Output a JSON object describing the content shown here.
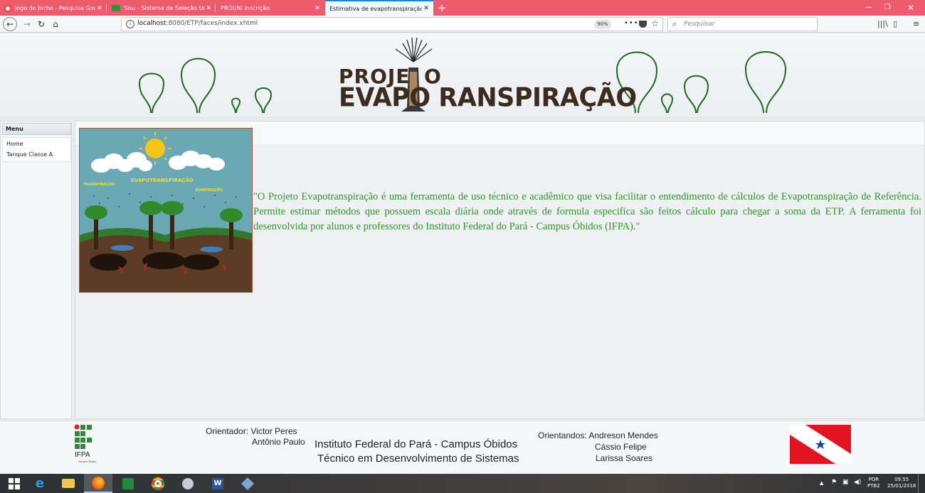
{
  "browser": {
    "tabs": [
      {
        "label": "jogo do bicho - Pesquisa Goog",
        "favicon": "google-icon"
      },
      {
        "label": "Sisu - Sistema de Seleção Unifi",
        "favicon": "brazil-flag-icon"
      },
      {
        "label": "PROUNI inscrição",
        "favicon": ""
      },
      {
        "label": "Estimativa de evapotranspiração",
        "favicon": ""
      }
    ],
    "url_host": "localhost",
    "url_path": ":8080/ETP/faces/index.xhtml",
    "zoom": "90%",
    "search_placeholder": "Pesquisar"
  },
  "header": {
    "logo_line1": "PROJE",
    "logo_line1_end": "O",
    "logo_line2": "EVAPO  RANSPIRAÇÃO"
  },
  "sidebar": {
    "title": "Menu",
    "items": [
      "Home",
      "Tanque Classe A"
    ]
  },
  "illustration": {
    "label_center": "EVAPOTRANSPIRAÇÃO",
    "label_left": "TRANSPIRAÇÃO",
    "label_right": "EVAPORAÇÃO"
  },
  "main": {
    "quote": "\"O Projeto Evapotranspiração é uma ferramenta de uso técnico e acadêmico que visa facilitar o entendimento de cálculos de Evapotranspiração de Referência. Permite estimar métodos que possuem escala diária onde através de formula especifica são feitos cálculo para chegar a soma da ETP. A ferramenta foi desenvolvida por alunos e professores do Instituto Federal do Pará - Campus Óbidos (IFPA).\""
  },
  "footer": {
    "ifpa_label": "IFPA",
    "ifpa_sub": "Campus Óbidos",
    "orientador_label": "Orientador: Victor Peres",
    "orientador_2": "Antônio Paulo",
    "institution": "Instituto Federal do Pará - Campus Óbidos",
    "course": "Técnico em Desenvolvimento de Sistemas",
    "orientandos_label": "Orientandos: Andreson Mendes",
    "orientando_2": "Cássio Felipe",
    "orientando_3": "Larissa Soares"
  },
  "taskbar": {
    "lang": "POR",
    "lang2": "PTB2",
    "time": "09:55",
    "date": "25/01/2018"
  },
  "colors": {
    "tabbar": "#ee5b6d",
    "quote_text": "#2a9a2a",
    "logo_text": "#3d2b1d",
    "tree_stroke": "#1d6b1d"
  }
}
